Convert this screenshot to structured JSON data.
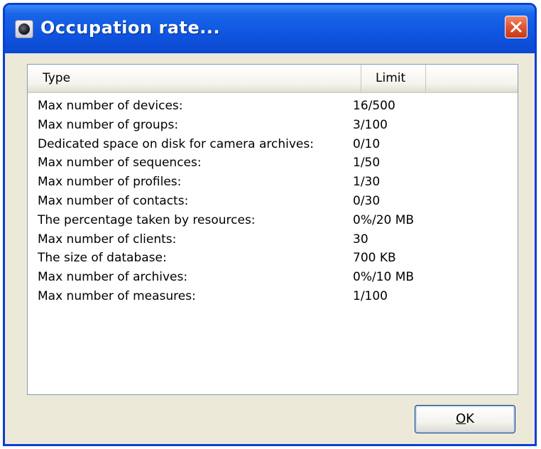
{
  "window": {
    "title": "Occupation rate...",
    "icon": "camera-app-icon",
    "close_icon": "close-icon"
  },
  "list": {
    "columns": [
      "Type",
      "Limit"
    ],
    "rows": [
      {
        "type": "Max number of devices:",
        "limit": "16/500"
      },
      {
        "type": "Max number of groups:",
        "limit": "3/100"
      },
      {
        "type": "Dedicated space on disk for camera archives:",
        "limit": "0/10"
      },
      {
        "type": "Max number of sequences:",
        "limit": "1/50"
      },
      {
        "type": "Max number of profiles:",
        "limit": "1/30"
      },
      {
        "type": "Max number of contacts:",
        "limit": "0/30"
      },
      {
        "type": "The percentage taken by resources:",
        "limit": "0%/20 MB"
      },
      {
        "type": "Max number of clients:",
        "limit": "30"
      },
      {
        "type": "The size of database:",
        "limit": "700 KB"
      },
      {
        "type": "Max number of archives:",
        "limit": "0%/10 MB"
      },
      {
        "type": "Max number of measures:",
        "limit": "1/100"
      }
    ]
  },
  "buttons": {
    "ok_mnemonic": "O",
    "ok_rest": "K"
  },
  "colors": {
    "titlebar": "#0f55e0",
    "close_button": "#e0552f",
    "window_body": "#ece9d8",
    "list_border": "#7f9db9"
  }
}
